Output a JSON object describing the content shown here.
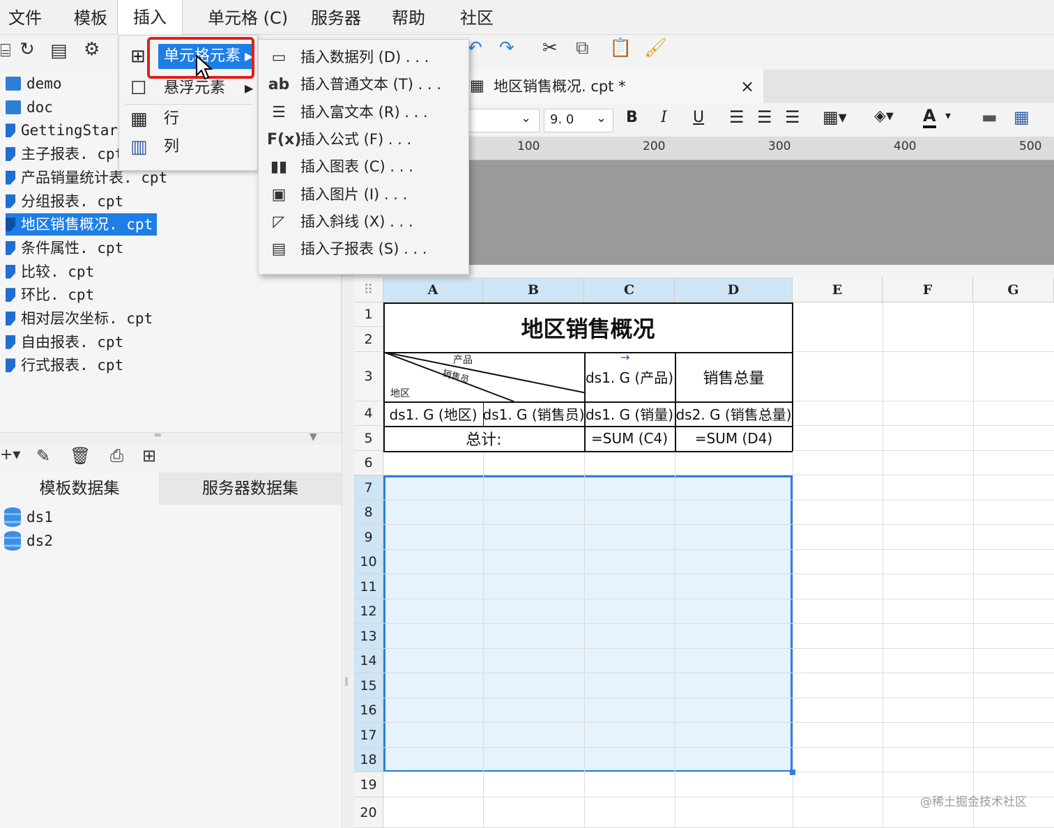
{
  "menubar": {
    "items": [
      "文件",
      "模板",
      "插入",
      "单元格 (C)",
      "服务器",
      "帮助",
      "社区"
    ]
  },
  "insert_menu": {
    "items": [
      {
        "label": "单元格元素",
        "icon": "cell-element-icon",
        "has_submenu": true,
        "highlighted": true
      },
      {
        "label": "悬浮元素",
        "icon": "float-element-icon",
        "has_submenu": true
      },
      {
        "label": "行",
        "icon": "row-icon"
      },
      {
        "label": "列",
        "icon": "column-icon"
      }
    ]
  },
  "cell_submenu": {
    "items": [
      {
        "label": "插入数据列 (D) . . .",
        "icon": "data-column-icon",
        "glyph": "▭"
      },
      {
        "label": "插入普通文本 (T) . . .",
        "icon": "text-icon",
        "glyph": "ab"
      },
      {
        "label": "插入富文本 (R) . . .",
        "icon": "rich-text-icon",
        "glyph": "☰"
      },
      {
        "label": "插入公式 (F) . . .",
        "icon": "formula-icon",
        "glyph": "F(x)"
      },
      {
        "label": "插入图表 (C) . . .",
        "icon": "chart-icon",
        "glyph": "▮▮"
      },
      {
        "label": "插入图片 (I) . . .",
        "icon": "image-icon",
        "glyph": "▣"
      },
      {
        "label": "插入斜线 (X) . . .",
        "icon": "slash-icon",
        "glyph": "◸"
      },
      {
        "label": "插入子报表 (S) . . .",
        "icon": "subreport-icon",
        "glyph": "▤"
      }
    ]
  },
  "file_tree": {
    "items": [
      {
        "label": "demo",
        "type": "folder"
      },
      {
        "label": "doc",
        "type": "folder"
      },
      {
        "label": "GettingStart",
        "type": "file"
      },
      {
        "label": "主子报表. cpt",
        "type": "file"
      },
      {
        "label": "产品销量统计表. cpt",
        "type": "file"
      },
      {
        "label": "分组报表. cpt",
        "type": "file"
      },
      {
        "label": "地区销售概况. cpt",
        "type": "file",
        "selected": true
      },
      {
        "label": "条件属性. cpt",
        "type": "file"
      },
      {
        "label": "比较. cpt",
        "type": "file"
      },
      {
        "label": "环比. cpt",
        "type": "file"
      },
      {
        "label": "相对层次坐标. cpt",
        "type": "file"
      },
      {
        "label": "自由报表. cpt",
        "type": "file"
      },
      {
        "label": "行式报表. cpt",
        "type": "file"
      }
    ]
  },
  "dataset_tabs": [
    "模板数据集",
    "服务器数据集"
  ],
  "datasets": [
    "ds1",
    "ds2"
  ],
  "doc_tab": {
    "title": "地区销售概况. cpt *",
    "close": "×"
  },
  "format_bar": {
    "font_size": "9. 0",
    "bold": "B",
    "italic": "I",
    "underline": "U",
    "font_color": "A"
  },
  "ruler": {
    "labels": [
      "100",
      "200",
      "300",
      "400",
      "500"
    ]
  },
  "sheet": {
    "columns": [
      "A",
      "B",
      "C",
      "D",
      "E",
      "F",
      "G"
    ],
    "rows": [
      "1",
      "2",
      "3",
      "4",
      "5",
      "6",
      "7",
      "8",
      "9",
      "10",
      "11",
      "12",
      "13",
      "14",
      "15",
      "16",
      "17",
      "18",
      "19",
      "20"
    ],
    "title": "地区销售概况",
    "slash_header": {
      "top": "产品",
      "middle": "销售员",
      "bottom": "地区"
    },
    "c3": "ds1. G (产品)",
    "d3": "销售总量",
    "a4": "ds1. G (地区)",
    "b4": "ds1. G (销售员)",
    "c4": "ds1. G (销量)",
    "d4": "ds2. G (销售总量)",
    "a5": "总计:",
    "c5": "=SUM (C4)",
    "d5": "=SUM (D4)"
  },
  "colors": {
    "accent": "#1e7ee6",
    "selection_fill": "#e6f2fc",
    "selection_border": "#2f7fe0",
    "highlight_box": "#e0201b"
  },
  "watermark": "@稀土掘金技术社区"
}
